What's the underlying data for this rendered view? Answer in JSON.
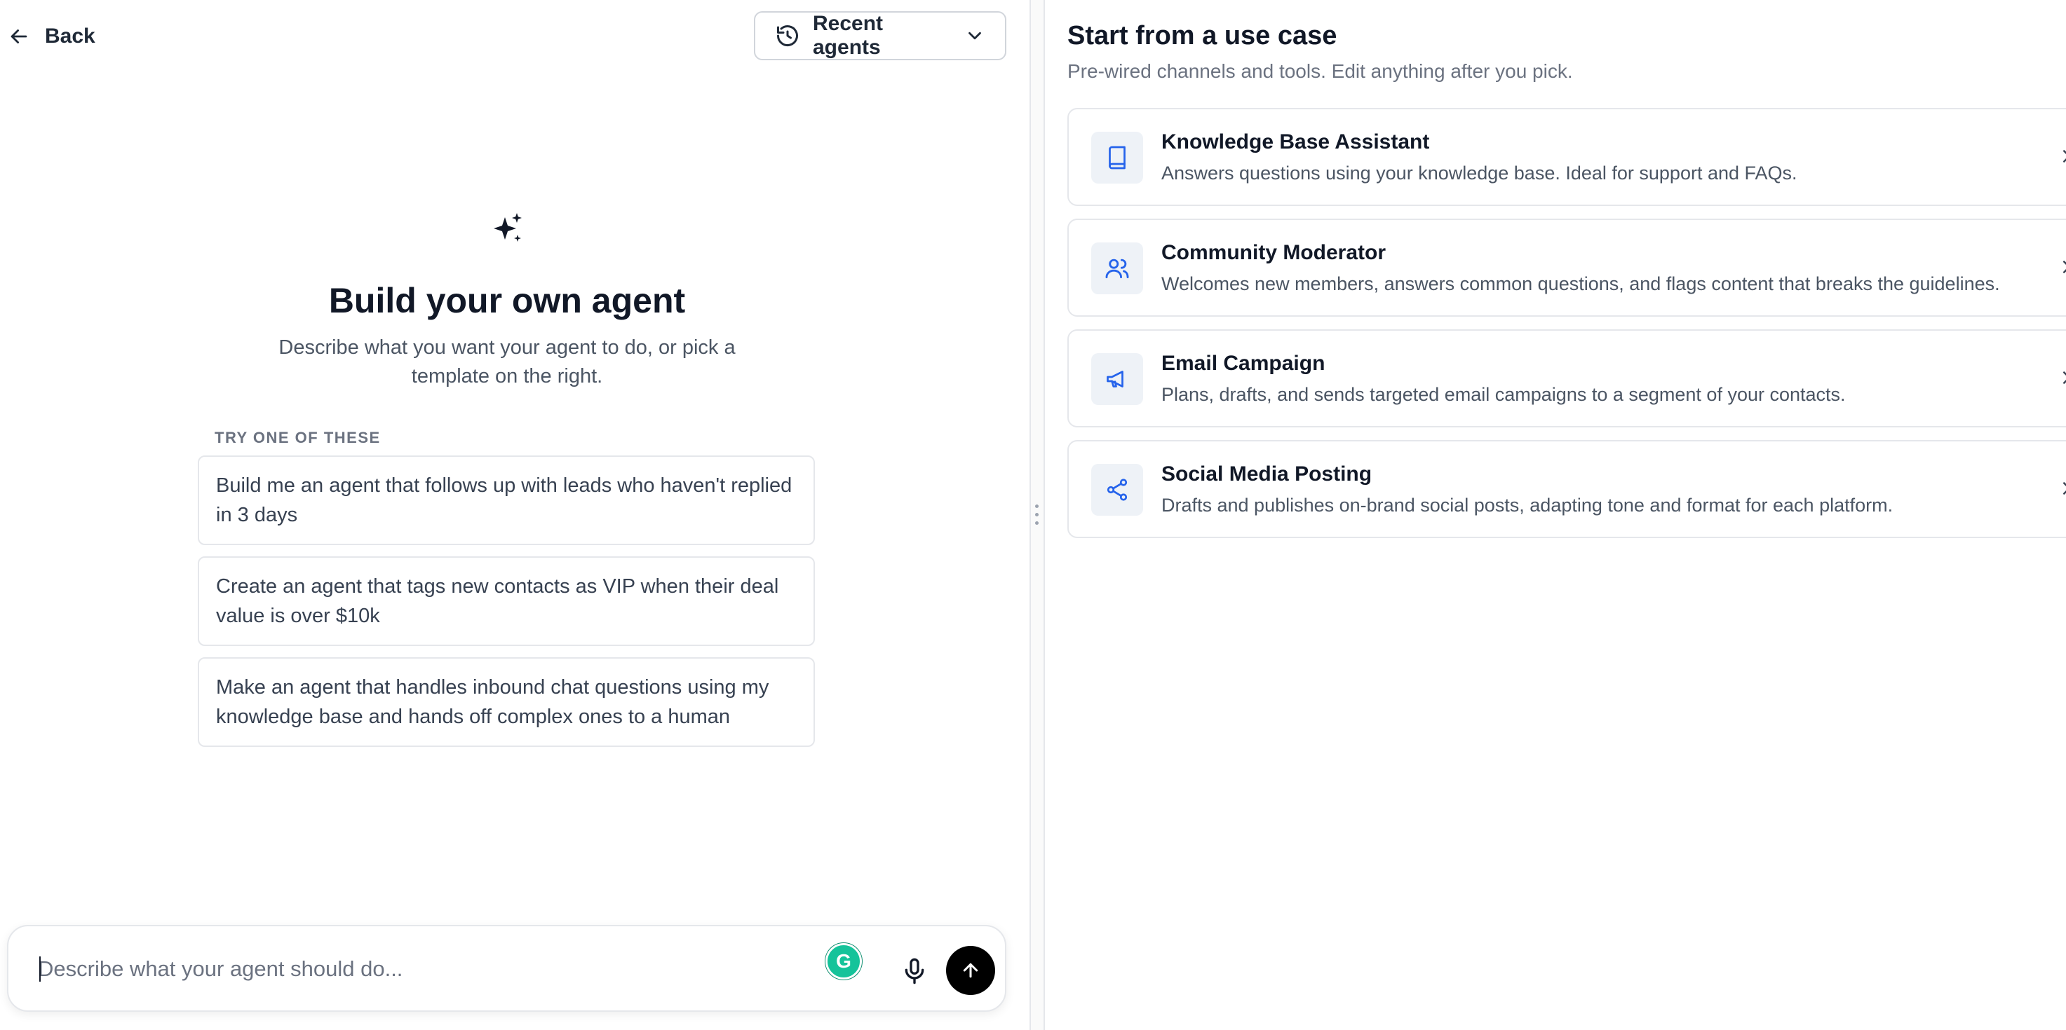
{
  "header": {
    "back_label": "Back",
    "recent_agents_label": "Recent agents"
  },
  "builder": {
    "title": "Build your own agent",
    "subtitle": "Describe what you want your agent to do, or pick a template on the right.",
    "suggestions_label": "TRY ONE OF THESE",
    "suggestions": [
      "Build me an agent that follows up with leads who haven't replied in 3 days",
      "Create an agent that tags new contacts as VIP when their deal value is over $10k",
      "Make an agent that handles inbound chat questions using my knowledge base and hands off complex ones to a human"
    ]
  },
  "composer": {
    "placeholder": "Describe what your agent should do...",
    "grammarly_letter": "G"
  },
  "use_cases": {
    "title": "Start from a use case",
    "subtitle": "Pre-wired channels and tools. Edit anything after you pick.",
    "items": [
      {
        "icon": "book-icon",
        "name": "Knowledge Base Assistant",
        "description": "Answers questions using your knowledge base. Ideal for support and FAQs."
      },
      {
        "icon": "users-icon",
        "name": "Community Moderator",
        "description": "Welcomes new members, answers common questions, and flags content that breaks the guidelines."
      },
      {
        "icon": "megaphone-icon",
        "name": "Email Campaign",
        "description": "Plans, drafts, and sends targeted email campaigns to a segment of your contacts."
      },
      {
        "icon": "share-icon",
        "name": "Social Media Posting",
        "description": "Drafts and publishes on-brand social posts, adapting tone and format for each platform."
      }
    ]
  },
  "colors": {
    "icon_accent": "#2563eb",
    "icon_bg": "#eef2f7",
    "send_button": "#000000",
    "grammarly": "#15c39a"
  }
}
